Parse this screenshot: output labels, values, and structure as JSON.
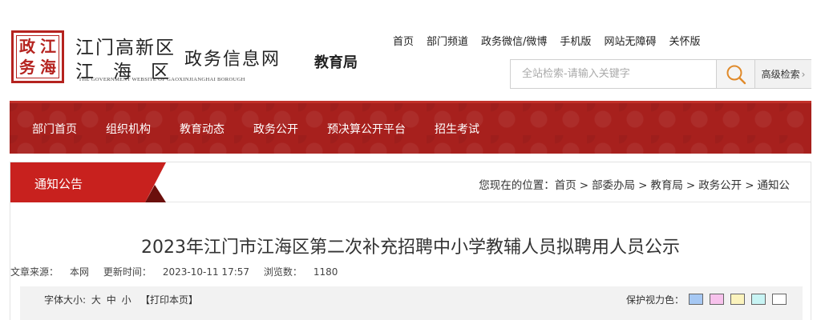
{
  "header": {
    "seal_chars": [
      "政",
      "江",
      "务",
      "海"
    ],
    "logo_line1": "江门高新区",
    "logo_line2_chars": [
      "江",
      "海",
      "区"
    ],
    "logo_main": "政务信息网",
    "logo_en": "THE GOVERNMENT WEBSITE OF GAOXINJIANGHAI BOROUGH",
    "dept": "教育局",
    "links": [
      "首页",
      "部门频道",
      "政务微信/微博",
      "手机版",
      "网站无障碍",
      "关怀版"
    ],
    "search_placeholder": "全站检索-请输入关键字",
    "advanced_search": "高级检索",
    "advanced_chevron": "›"
  },
  "nav": {
    "items": [
      "部门首页",
      "组织机构",
      "教育动态",
      "政务公开",
      "预决算公开平台",
      "招生考试"
    ]
  },
  "section": {
    "tab_label": "通知公告",
    "breadcrumb_prefix": "您现在的位置：",
    "breadcrumb": [
      "首页",
      "部委办局",
      "教育局",
      "政务公开",
      "通知公"
    ]
  },
  "article": {
    "title": "2023年江门市江海区第二次补充招聘中小学教辅人员拟聘用人员公示",
    "source_label": "文章来源：",
    "source": "本网",
    "updated_label": "更新时间：",
    "updated": "2023-10-11 17:57",
    "views_label": "浏览数：",
    "views": "1180"
  },
  "toolbar": {
    "font_size_label": "字体大小:",
    "sizes": [
      "大",
      "中",
      "小"
    ],
    "print": "【打印本页】",
    "eye_label": "保护视力色：",
    "swatch_colors": [
      "#a6c8f3",
      "#f7c2ec",
      "#fbf3bd",
      "#c8f4f4",
      "#ffffff"
    ]
  },
  "colors": {
    "brand_red": "#c8211e",
    "nav_red": "#a7201d"
  }
}
